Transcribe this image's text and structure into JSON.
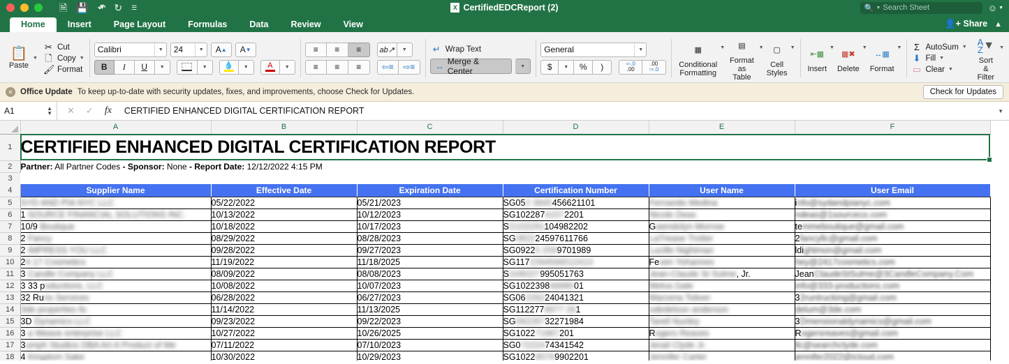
{
  "window": {
    "title": "CertifiedEDCReport (2)",
    "app_icon": "excel-icon",
    "accent": "#217346",
    "traffic_lights": [
      "close",
      "minimize",
      "maximize"
    ],
    "quick_access": [
      "new-icon",
      "save-icon",
      "undo-icon",
      "redo-icon",
      "customize-icon"
    ]
  },
  "search": {
    "placeholder": "Search Sheet",
    "icon": "search-icon"
  },
  "share": {
    "label": "Share",
    "icon": "share-person-icon",
    "collapse_icon": "chevron-up-icon"
  },
  "help": {
    "icon": "smiley-icon"
  },
  "tabs": [
    {
      "label": "Home",
      "active": true
    },
    {
      "label": "Insert",
      "active": false
    },
    {
      "label": "Page Layout",
      "active": false
    },
    {
      "label": "Formulas",
      "active": false
    },
    {
      "label": "Data",
      "active": false
    },
    {
      "label": "Review",
      "active": false
    },
    {
      "label": "View",
      "active": false
    }
  ],
  "ribbon": {
    "clipboard": {
      "paste_label": "Paste",
      "cut_label": "Cut",
      "copy_label": "Copy",
      "format_label": "Format"
    },
    "font": {
      "family": "Calibri",
      "size": "24",
      "grow_label": "A",
      "shrink_label": "A",
      "bold_label": "B",
      "italic_label": "I",
      "underline_label": "U",
      "bold_active": true
    },
    "alignment": {
      "wrap_text_label": "Wrap Text",
      "merge_center_label": "Merge & Center",
      "merge_active": true,
      "bottom_align_active": true
    },
    "number": {
      "format": "General",
      "currency_label": "$",
      "percent_label": "%",
      "comma_label": ")",
      "inc_decimal_label": ".00",
      "dec_decimal_label": ".00"
    },
    "styles": {
      "conditional_line1": "Conditional",
      "conditional_line2": "Formatting",
      "table_line1": "Format",
      "table_line2": "as Table",
      "cellstyles_line1": "Cell",
      "cellstyles_line2": "Styles"
    },
    "cells": {
      "insert_label": "Insert",
      "delete_label": "Delete",
      "format_label": "Format"
    },
    "editing": {
      "autosum_label": "AutoSum",
      "fill_label": "Fill",
      "clear_label": "Clear",
      "sort_line1": "Sort &",
      "sort_line2": "Filter"
    }
  },
  "notification": {
    "title": "Office Update",
    "message": "To keep up-to-date with security updates, fixes, and improvements, choose Check for Updates.",
    "button": "Check for Updates",
    "close_icon": "close-icon"
  },
  "formula_bar": {
    "name_box": "A1",
    "cancel_icon": "cancel-icon",
    "accept_icon": "accept-icon",
    "fx_icon": "fx-icon",
    "content": "CERTIFIED ENHANCED DIGITAL CERTIFICATION REPORT",
    "collapse_icon": "chevron-down-icon"
  },
  "sheet": {
    "columns": [
      "A",
      "B",
      "C",
      "D",
      "E",
      "F"
    ],
    "row_numbers": [
      "1",
      "2",
      "3",
      "4",
      "5",
      "6",
      "7",
      "8",
      "9",
      "10",
      "11",
      "12",
      "13",
      "14",
      "15",
      "16",
      "17",
      "18"
    ],
    "title_row": "CERTIFIED ENHANCED DIGITAL CERTIFICATION REPORT",
    "meta_row": {
      "partner_label": "Partner:",
      "partner_value": "All Partner Codes",
      "sep1": "-",
      "sponsor_label": "Sponsor:",
      "sponsor_value": "None",
      "sep2": "-",
      "date_label": "Report Date:",
      "date_value": "12/12/2022 4:15 PM"
    },
    "header_bg": "#4472f0",
    "headers": [
      "Supplier Name",
      "Effective Date",
      "Expiration Date",
      "Certification Number",
      "User Name",
      "User Email"
    ],
    "rows": [
      {
        "supplier": "SYD AND PIA NYC LLC",
        "supplier_blurred": true,
        "effective": "05/22/2022",
        "expiration": "05/21/2023",
        "cert_clear1": "SG05",
        "cert_hidden": "2 3845",
        "cert_clear2": "45662",
        "cert_tail": "1101",
        "cert_full": "SG052 3845662 1101",
        "user": "Fernando Medina",
        "user_blurred": true,
        "email_clear": "i",
        "email_rest": "nfo@sydandpianyc.com",
        "email_full": "info@sydandpianyc.com"
      },
      {
        "supplier": "1 SOURCE FINANCIAL SOLUTIONS INC.",
        "supplier_prefix": "1",
        "supplier_blurred": true,
        "effective": "10/13/2022",
        "expiration": "10/12/2023",
        "cert_clear1": "SG102287",
        "cert_hidden": "4157",
        "cert_clear2": "2201",
        "cert_tail": "",
        "cert_full": "SG1022874157 2201",
        "user": "Nicole Deas",
        "user_blurred": true,
        "email_clear": "",
        "email_rest": "ndeas@1sourceco.com",
        "email_full": "ndeas@1sourceco.com"
      },
      {
        "supplier": "10/9 Boutique",
        "supplier_prefix": "10/9",
        "supplier_blurred": true,
        "effective": "10/18/2022",
        "expiration": "10/17/2023",
        "cert_clear1": "S",
        "cert_hidden": "G102291",
        "cert_clear2": "104982",
        "cert_tail": "202",
        "cert_full": "SG102291104982202",
        "user": "Gwendolyn Morrow",
        "user_prefix": "G",
        "user_blurred": true,
        "email_clear": "te",
        "email_rest": "mmeboutique@gmail.com",
        "email_full": "temmeboutique@gmail.com"
      },
      {
        "supplier": "2 Fancy",
        "supplier_prefix": "2",
        "supplier_blurred": true,
        "effective": "08/29/2022",
        "expiration": "08/28/2023",
        "cert_clear1": "SG",
        "cert_hidden": "0822",
        "cert_clear2": "24597611766",
        "cert_tail": "",
        "cert_full": "SG082224597611766",
        "user": "LaTrease Trotter",
        "user_blurred": true,
        "email_clear": "2",
        "email_rest": "fancyllc@gmail.com",
        "email_full": "2fancyllc@gmail.com"
      },
      {
        "supplier": "2 IMPRESS YOU LLC",
        "supplier_prefix": "2",
        "supplier_blurred": true,
        "effective": "09/28/2022",
        "expiration": "09/27/2023",
        "cert_clear1": "SG0922",
        "cert_hidden": "5 259",
        "cert_clear2": "9701989",
        "cert_tail": "",
        "cert_full": "SG09225 2599701989",
        "user": "Lucille Nightman",
        "user_blurred": true,
        "email_clear": "ldi",
        "email_rest": "ghtmon@gmail.com",
        "email_full": "ldightmon@gmail.com"
      },
      {
        "supplier": "24 17 Cosmetics",
        "supplier_prefix": "2",
        "supplier_blurred": true,
        "effective": "11/19/2022",
        "expiration": "11/18/2025",
        "cert_clear1": "SG117",
        "cert_hidden": "2294566512413",
        "cert_clear2": "",
        "cert_tail": "",
        "cert_full": "SG1172294566512413",
        "user": "Feven Yohannes",
        "user_prefix": "Fe",
        "user_blurred": true,
        "email_clear": "",
        "email_rest": "hey@2417cosmetics.com",
        "email_full": "hey@2417cosmetics.com"
      },
      {
        "supplier": "3 Candle Company LLC",
        "supplier_prefix": "3",
        "supplier_blurred": true,
        "effective": "08/09/2022",
        "expiration": "08/08/2023",
        "cert_clear1": "S",
        "cert_hidden": "G08227",
        "cert_clear2": "995051763",
        "cert_tail": "",
        "cert_full": "SG08227995051763",
        "user": "Jean-Claude St Sulme, Jr.",
        "user_suffix": ", Jr.",
        "user_blurred": true,
        "email_clear": "Jean",
        "email_rest": "ClaudeStSulme@3CandleCompany.Com",
        "email_full": "JeanClaudeStSulme@3CandleCompany.Com"
      },
      {
        "supplier": "333 productions, LLC",
        "supplier_prefix": "3 33 p",
        "supplier_blurred": true,
        "effective": "10/08/2022",
        "expiration": "10/07/2023",
        "cert_clear1": "SG1022398",
        "cert_hidden": "66880",
        "cert_clear2": "01",
        "cert_tail": "",
        "cert_full": "SG10223986688001",
        "user": "Melva Gale",
        "user_blurred": true,
        "email_clear": "",
        "email_rest": "info@333-productions.com",
        "email_full": "info@333-productions.com"
      },
      {
        "supplier": "32 Runs Services",
        "supplier_prefix": "32 Ru",
        "supplier_blurred": true,
        "effective": "06/28/2022",
        "expiration": "06/27/2023",
        "cert_clear1": "SG06",
        "cert_hidden": "2262",
        "cert_clear2": "24041321",
        "cert_tail": "",
        "cert_full": "SG06226224041321",
        "user": "Marcena Toliver",
        "user_blurred": true,
        "email_clear": "3",
        "email_rest": "2runtrucking@gmail.com",
        "email_full": "32runtrucking@gmail.com"
      },
      {
        "supplier": "3de properties llc",
        "supplier_blurred": true,
        "effective": "11/14/2022",
        "expiration": "11/13/2025",
        "cert_clear1": "SG112277",
        "cert_hidden": "9977 26",
        "cert_clear2": "1",
        "cert_tail": "",
        "cert_full": "SG1122779977261",
        "user": "odedelson anderson",
        "user_blurred": true,
        "email_clear": "",
        "email_rest": "delum@3de.com",
        "email_full": "delum@3de.com"
      },
      {
        "supplier": "3D Dynamics LLC",
        "supplier_prefix": "3D",
        "supplier_blurred": true,
        "effective": "09/23/2022",
        "expiration": "09/22/2023",
        "cert_clear1": "SG",
        "cert_hidden": "092287",
        "cert_clear2": "32271984",
        "cert_tail": "",
        "cert_full": "SG09228732271984",
        "user": "Tarell Nunley",
        "user_blurred": true,
        "email_clear": "3",
        "email_rest": "Dmensionaldynamics@gmail.com",
        "email_full": "3Dmensionaldynamics@gmail.com"
      },
      {
        "supplier": "3 a Weave enterprise LLC",
        "supplier_prefix": "3",
        "supplier_blurred": true,
        "effective": "10/27/2022",
        "expiration": "10/26/2025",
        "cert_clear1": "SG1022",
        "cert_hidden": "71967",
        "cert_clear2": "201",
        "cert_tail": "",
        "cert_full": "SG102271967201",
        "user": "Rogers Reaves",
        "user_prefix": "R",
        "user_blurred": true,
        "email_clear": "R",
        "email_rest": "ogersreaves@gmail.com",
        "email_full": "Rogersreaves@gmail.com"
      },
      {
        "supplier": "3umph Studios DBA Art A Product of Me",
        "supplier_prefix": "3",
        "supplier_blurred": true,
        "effective": "07/11/2022",
        "expiration": "07/10/2023",
        "cert_clear1": "SG0",
        "cert_hidden": "72224",
        "cert_clear2": "74341542",
        "cert_tail": "",
        "cert_full": "SG0722247 4341542",
        "user": "Jerail Clyde Jr.",
        "user_blurred": true,
        "email_clear": "",
        "email_rest": "llc@searchclyde.com",
        "email_full": "llc@searchclyde.com"
      },
      {
        "supplier": "4 Kingdom Sake",
        "supplier_prefix": "4",
        "supplier_blurred": true,
        "effective": "10/30/2022",
        "expiration": "10/29/2023",
        "cert_clear1": "SG1022",
        "cert_hidden": "9579",
        "cert_clear2": "9902201",
        "cert_tail": "",
        "cert_full": "SG10229579902201",
        "user": "Jennifer Carter",
        "user_blurred": true,
        "email_clear": "",
        "email_rest": "jennifer2022@icloud.com",
        "email_full": "jennifer2022@icloud.com"
      }
    ]
  }
}
